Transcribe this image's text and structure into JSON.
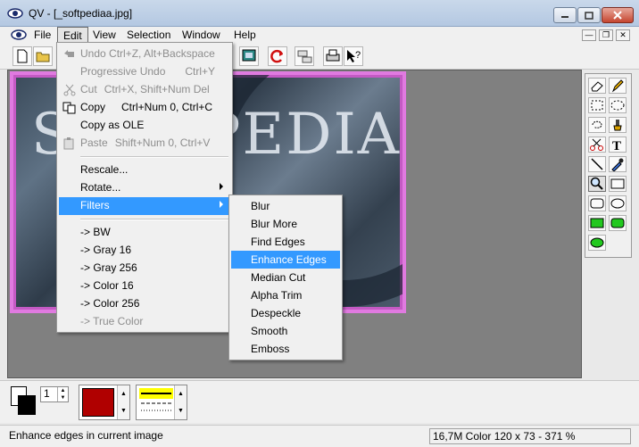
{
  "window": {
    "title": "QV - [_softpediaa.jpg]"
  },
  "menubar": {
    "items": [
      "File",
      "Edit",
      "View",
      "Selection",
      "Window",
      "Help"
    ]
  },
  "edit_menu": {
    "items": [
      {
        "label": "Undo Ctrl+Z, Alt+Backspace",
        "shortcut": "",
        "disabled": true
      },
      {
        "label": "Progressive Undo",
        "shortcut": "Ctrl+Y",
        "disabled": true
      },
      {
        "label": "Cut",
        "shortcut": "Ctrl+X, Shift+Num Del",
        "disabled": true
      },
      {
        "label": "Copy",
        "shortcut": "Ctrl+Num 0, Ctrl+C",
        "disabled": false
      },
      {
        "label": "Copy as OLE",
        "shortcut": "",
        "disabled": false
      },
      {
        "label": "Paste",
        "shortcut": "Shift+Num 0, Ctrl+V",
        "disabled": true
      },
      {
        "label": "Rescale...",
        "shortcut": "",
        "disabled": false
      },
      {
        "label": "Rotate...",
        "shortcut": "",
        "disabled": false
      },
      {
        "label": "Filters",
        "shortcut": "",
        "disabled": false
      },
      {
        "label": "-> BW",
        "shortcut": "",
        "disabled": false
      },
      {
        "label": "-> Gray 16",
        "shortcut": "",
        "disabled": false
      },
      {
        "label": "-> Gray 256",
        "shortcut": "",
        "disabled": false
      },
      {
        "label": "-> Color 16",
        "shortcut": "",
        "disabled": false
      },
      {
        "label": "-> Color 256",
        "shortcut": "",
        "disabled": false
      },
      {
        "label": "-> True Color",
        "shortcut": "",
        "disabled": true
      }
    ]
  },
  "filters_menu": {
    "items": [
      "Blur",
      "Blur More",
      "Find Edges",
      "Enhance Edges",
      "Median Cut",
      "Alpha Trim",
      "Despeckle",
      "Smooth",
      "Emboss"
    ],
    "highlighted": "Enhance Edges"
  },
  "image": {
    "watermark_text": "SOFTPEDIA"
  },
  "palette": {
    "line_width": "1",
    "color": "#b00000"
  },
  "status": {
    "message": "Enhance edges in current image",
    "info": "16,7M Color 120 x 73 - 371 %"
  }
}
